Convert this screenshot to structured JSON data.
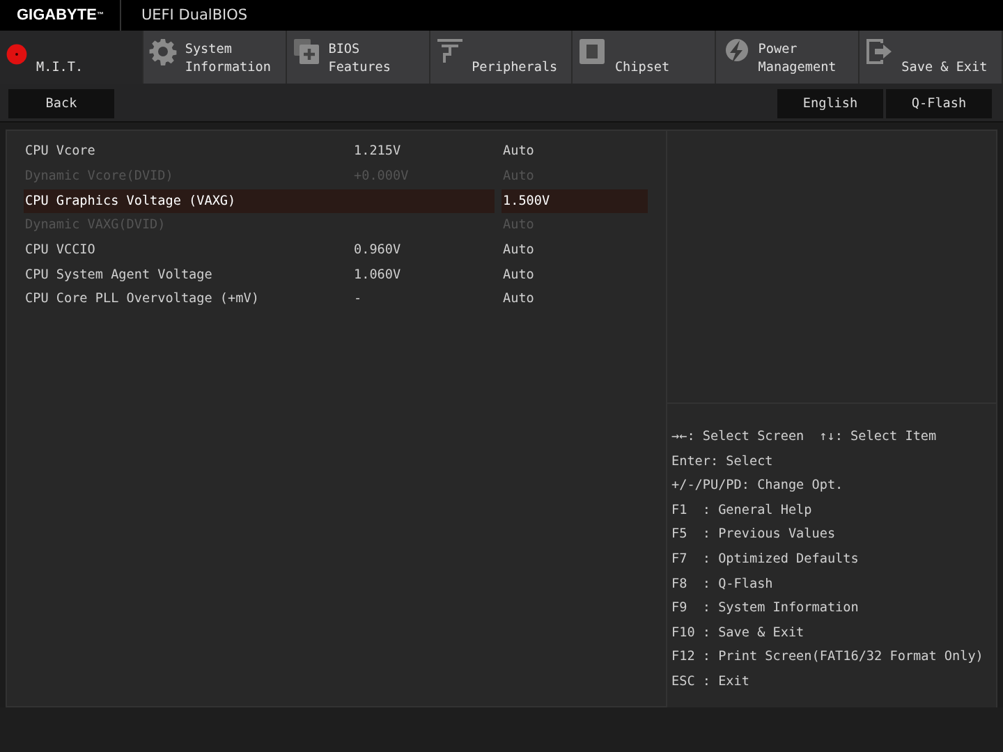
{
  "header": {
    "brand": "GIGABYTE",
    "trademark": "™",
    "title": "UEFI DualBIOS"
  },
  "tabs": [
    {
      "label": "M.I.T.",
      "kind": "dot",
      "selected": true
    },
    {
      "label": "System\nInformation",
      "kind": "gear",
      "selected": false
    },
    {
      "label": "BIOS\nFeatures",
      "kind": "add",
      "selected": false
    },
    {
      "label": "Peripherals",
      "kind": "port",
      "selected": false
    },
    {
      "label": "Chipset",
      "kind": "chip",
      "selected": false
    },
    {
      "label": "Power\nManagement",
      "kind": "power",
      "selected": false
    },
    {
      "label": "Save & Exit",
      "kind": "exit",
      "selected": false
    }
  ],
  "back_button": "Back",
  "right_buttons": [
    "English",
    "Q-Flash"
  ],
  "settings": [
    {
      "name": "CPU Vcore",
      "reading": "1.215V",
      "value": "Auto",
      "disabled": false,
      "selected": false
    },
    {
      "name": "Dynamic Vcore(DVID)",
      "reading": "+0.000V",
      "value": "Auto",
      "disabled": true,
      "selected": false
    },
    {
      "name": "CPU Graphics Voltage (VAXG)",
      "value": "1.500V",
      "disabled": false,
      "selected": true
    },
    {
      "name": "Dynamic VAXG(DVID)",
      "value": "Auto",
      "disabled": true,
      "selected": false
    },
    {
      "name": "CPU VCCIO",
      "reading": "0.960V",
      "value": "Auto",
      "disabled": false,
      "selected": false
    },
    {
      "name": "CPU System Agent Voltage",
      "reading": "1.060V",
      "value": "Auto",
      "disabled": false,
      "selected": false
    },
    {
      "name": "CPU Core PLL Overvoltage (+mV)",
      "reading": "-",
      "value": "Auto",
      "disabled": false,
      "selected": false
    }
  ],
  "help": [
    [
      "→←: Select Screen",
      "↑↓: Select Item"
    ],
    [
      "Enter: Select"
    ],
    [
      "+/-/PU/PD: Change Opt."
    ],
    [
      "F1  : General Help"
    ],
    [
      "F5  : Previous Values"
    ],
    [
      "F7  : Optimized Defaults"
    ],
    [
      "F8  : Q-Flash"
    ],
    [
      "F9  : System Information"
    ],
    [
      "F10 : Save & Exit"
    ],
    [
      "F12 : Print Screen(FAT16/32 Format Only)"
    ],
    [
      "ESC : Exit"
    ]
  ]
}
